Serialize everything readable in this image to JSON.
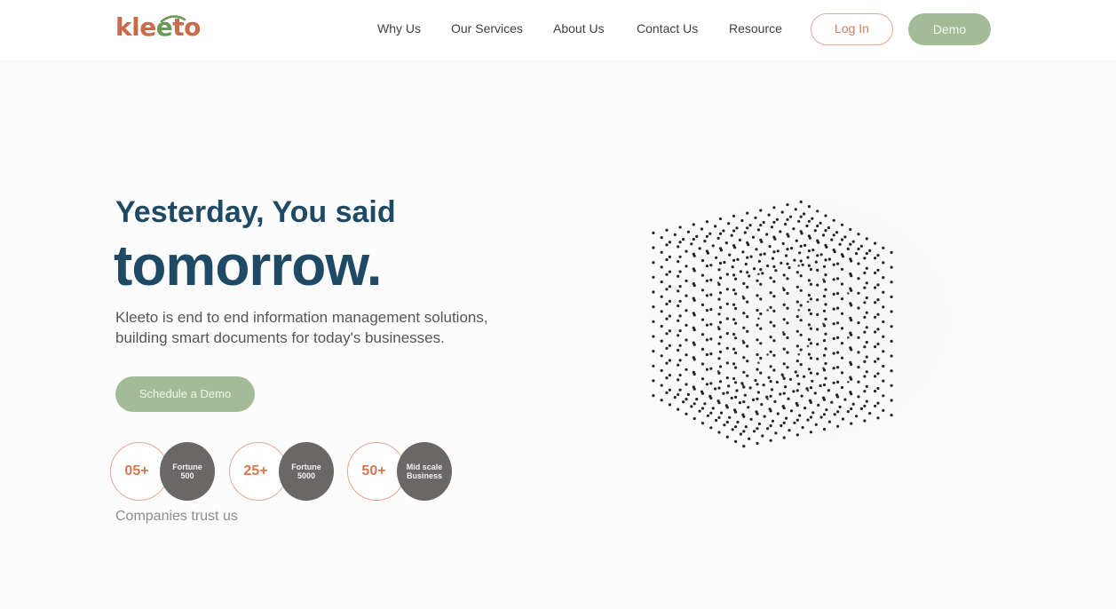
{
  "brand": {
    "logo_text_1": "kle",
    "logo_text_2": "e",
    "logo_text_3": "to"
  },
  "nav": {
    "items": [
      "Why Us",
      "Our Services",
      "About Us",
      "Contact Us",
      "Resource"
    ],
    "login_label": "Log In",
    "demo_label": "Demo"
  },
  "hero": {
    "line1": "Yesterday, You said",
    "line2": "tomorrow.",
    "description_line1": "Kleeto is end to end information management solutions,",
    "description_line2": "building smart documents for today's businesses.",
    "cta_label": "Schedule a Demo"
  },
  "stats": {
    "items": [
      {
        "number": "05+",
        "label_line1": "Fortune",
        "label_line2": "500"
      },
      {
        "number": "25+",
        "label_line1": "Fortune",
        "label_line2": "5000"
      },
      {
        "number": "50+",
        "label_line1": "Mid scale",
        "label_line2": "Business"
      }
    ],
    "caption": "Companies trust us"
  },
  "colors": {
    "brand_orange": "#c96b4a",
    "brand_green": "#a3bc97",
    "heading_blue": "#1e4a66",
    "stat_grey": "#6a6766",
    "ring_peach": "#e3a793"
  },
  "graphic": {
    "icon": "dotted-cube-graphic"
  }
}
